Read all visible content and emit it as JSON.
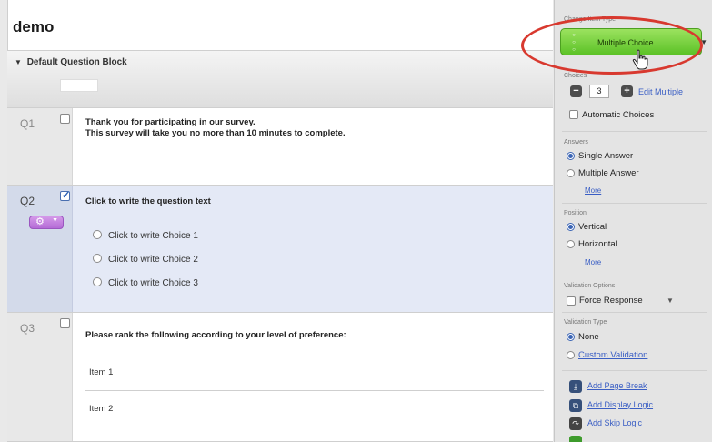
{
  "survey": {
    "title": "demo"
  },
  "block": {
    "title": "Default Question Block"
  },
  "questions": [
    {
      "number": "Q1",
      "checked": false,
      "text_line1": "Thank you for participating in our survey.",
      "text_line2": "This survey will take you no more than 10 minutes to complete."
    },
    {
      "number": "Q2",
      "checked": true,
      "text": "Click to write the question text",
      "choices": [
        "Click to write Choice 1",
        "Click to write Choice 2",
        "Click to write Choice 3"
      ]
    },
    {
      "number": "Q3",
      "checked": false,
      "text": "Please rank the following according to your level of preference:",
      "items": [
        "Item 1",
        "Item 2"
      ]
    }
  ],
  "panel": {
    "change_item_type_label": "Change Item Type",
    "item_type_value": "Multiple Choice",
    "choices_label": "Choices",
    "choices_count": "3",
    "edit_multiple": "Edit Multiple",
    "automatic_choices": "Automatic Choices",
    "answers_label": "Answers",
    "answers_options": [
      "Single Answer",
      "Multiple Answer"
    ],
    "answers_selected": "Single Answer",
    "more_label": "More",
    "position_label": "Position",
    "position_options": [
      "Vertical",
      "Horizontal"
    ],
    "position_selected": "Vertical",
    "validation_options_label": "Validation Options",
    "force_response": "Force Response",
    "validation_type_label": "Validation Type",
    "validation_type_options": [
      "None",
      "Custom Validation"
    ],
    "validation_type_selected": "None",
    "actions": [
      "Add Page Break",
      "Add Display Logic",
      "Add Skip Logic"
    ]
  },
  "colors": {
    "item_type_green": "#5cc227",
    "highlight_red": "#d8392f",
    "selected_question_bg": "#e4e9f6",
    "question_menu_purple": "#b46bd6",
    "link_blue": "#3a5ec4"
  },
  "icons": {
    "question_menu": "gear-icon",
    "item_type_handle": "three-dots-icon",
    "cursor": "hand-pointer-icon",
    "choices_minus": "minus-icon",
    "choices_plus": "plus-icon",
    "page_break": "page-break-icon",
    "display_logic": "display-logic-icon",
    "skip_logic": "skip-logic-icon"
  }
}
